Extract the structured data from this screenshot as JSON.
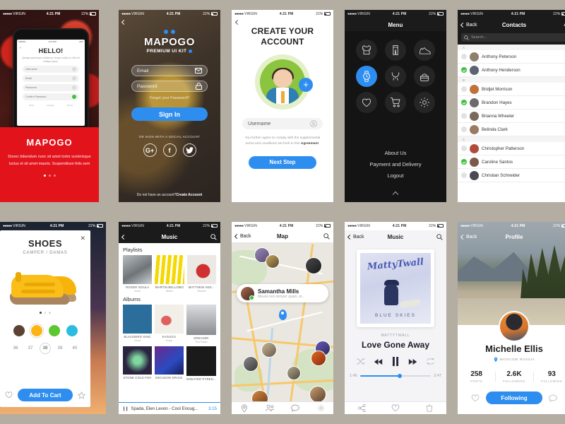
{
  "statusbar": {
    "carrier": "VIRGIN",
    "time": "4:21 PM",
    "battery": "22%",
    "signal_dots": "●●●●●"
  },
  "screen1": {
    "inner": {
      "back_icon": "chevron-left-icon",
      "title": "HELLO!",
      "subtitle": "Quisque justo turpis vestibulum, tempor mollis mi. Sed vel tristique quam.",
      "fields": [
        {
          "label": "Username",
          "icon": "user-icon"
        },
        {
          "label": "Email",
          "icon": "mail-icon"
        },
        {
          "label": "Password",
          "icon": "lock-icon"
        },
        {
          "label": "Confirm Password",
          "icon": "check-icon"
        }
      ],
      "strength": [
        {
          "label": "Weak",
          "color": "#e3131c"
        },
        {
          "label": "Average",
          "color": "#f5a623"
        },
        {
          "label": "Strong",
          "color": "#3ec13e"
        }
      ]
    },
    "card": {
      "title": "MAPOGO",
      "body": "Donec bibendum nunc sit amet tortor scelerisque luctus et sit amet mauris. Suspendisse felis sem",
      "bg_color": "#e3131c"
    }
  },
  "screen2": {
    "back_icon": "chevron-left-icon",
    "title": "MAPOGO",
    "subtitle": "PREMIUM UI KIT",
    "fields": [
      {
        "placeholder": "Email",
        "icon": "mail-icon"
      },
      {
        "placeholder": "Password",
        "icon": "lock-icon"
      }
    ],
    "forgot": "Forgot your Password?",
    "signin": "Sign In",
    "social_prompt": "OR SIGN WITH A SOCIAL ACCOUNT",
    "socials": [
      "G+",
      "f",
      "t"
    ],
    "bottom_text": "Do not have an account?",
    "bottom_link": "Create Account",
    "accent": "#2e8ef0"
  },
  "screen3": {
    "back_icon": "chevron-left-icon",
    "title_line1": "CREATE YOUR",
    "title_line2": "ACCOUNT",
    "add_photo_icon": "plus-icon",
    "field": {
      "placeholder": "Username",
      "icon": "user-icon"
    },
    "terms_prefix": "You further agree to comply with the supplemental terms and conditions set forth in this ",
    "terms_link": "Agreement",
    "terms_suffix": ".",
    "next_button": "Next Step"
  },
  "screen4": {
    "title": "Menu",
    "icons": [
      {
        "name": "shirt-icon",
        "active": false
      },
      {
        "name": "pants-icon",
        "active": false
      },
      {
        "name": "shoe-icon",
        "active": false
      },
      {
        "name": "watch-icon",
        "active": true
      },
      {
        "name": "necklace-icon",
        "active": false
      },
      {
        "name": "handbag-icon",
        "active": false
      },
      {
        "name": "heart-icon",
        "active": false
      },
      {
        "name": "cart-icon",
        "active": false
      },
      {
        "name": "gear-icon",
        "active": false
      }
    ],
    "links": [
      "About Us",
      "Payment and Delivery",
      "Logout"
    ],
    "collapse_icon": "chevron-up-icon",
    "accent": "#2e8ef0"
  },
  "screen5": {
    "back": "Back",
    "title": "Contacts",
    "right_label": "A",
    "search_placeholder": "Search...",
    "sections": [
      {
        "letter": "A",
        "rows": [
          {
            "name": "Anthony Peterson",
            "selected": false,
            "avatar": "#8f7f6e"
          },
          {
            "name": "Anthony Henderson",
            "selected": true,
            "avatar": "#5c6470"
          }
        ]
      },
      {
        "letter": "B",
        "rows": [
          {
            "name": "Bridjet Morrison",
            "selected": false,
            "avatar": "#c0703a"
          },
          {
            "name": "Brandon Hayes",
            "selected": true,
            "avatar": "#6b6b6b"
          },
          {
            "name": "Brianna Wheeler",
            "selected": false,
            "avatar": "#7a6a5e"
          },
          {
            "name": "Belinda Clark",
            "selected": false,
            "avatar": "#9a7a62"
          }
        ]
      },
      {
        "letter": "C",
        "rows": [
          {
            "name": "Christopher Patterson",
            "selected": false,
            "avatar": "#b04a3a"
          },
          {
            "name": "Caroline Santos",
            "selected": true,
            "avatar": "#7c5a4a"
          },
          {
            "name": "Christian Schneider",
            "selected": false,
            "avatar": "#4a4a52"
          }
        ]
      }
    ]
  },
  "screen6": {
    "close_icon": "close-icon",
    "title": "SHOES",
    "subtitle": "CAMPER / DAMAS",
    "colors": [
      {
        "hex": "#5b4233",
        "selected": false
      },
      {
        "hex": "#fcb415",
        "selected": true
      },
      {
        "hex": "#5cc72e",
        "selected": false
      },
      {
        "hex": "#2bbce0",
        "selected": false
      }
    ],
    "sizes": [
      "36",
      "37",
      "38",
      "39",
      "40"
    ],
    "selected_size": "38",
    "heart_icon": "heart-icon",
    "star_icon": "star-icon",
    "cta": "Add To Cart"
  },
  "screen7": {
    "back_icon": "chevron-left-icon",
    "title": "Music",
    "search_icon": "search-icon",
    "playlists_heading": "Playlists",
    "playlists": [
      {
        "title": "ROGER GOULA",
        "sub": "Aves",
        "bg": "#9aa0a4"
      },
      {
        "title": "MARTIN BELLOMO",
        "sub": "Mimic",
        "bg": "#f5d800"
      },
      {
        "title": "MATTHEW AND...",
        "sub": "Temple",
        "bg": "#e8e6e2"
      }
    ],
    "albums_heading": "Albums",
    "albums": [
      {
        "title": "BLACKBIRD SING",
        "sub": "Circa",
        "bg": "#2b6e9c"
      },
      {
        "title": "KAGUGU",
        "sub": "Hope",
        "bg": "#f2eee8"
      },
      {
        "title": "GREAVER",
        "sub": "The Fawn",
        "bg": "#c8cacd"
      },
      {
        "title": "STONE COLD FOX",
        "sub": "",
        "bg": "#2a2440"
      },
      {
        "title": "DECISION SPACE",
        "sub": "",
        "bg": "#6a2a8a"
      },
      {
        "title": "GREATER PYREN...",
        "sub": "",
        "bg": "#1a1a1a"
      }
    ],
    "now_playing": "Spada, Elen Levon - Cool Enoug...",
    "now_playing_time": "3:15",
    "pause_icon": "pause-icon"
  },
  "screen8": {
    "back": "Back",
    "title": "Map",
    "search_icon": "search-icon",
    "card": {
      "name": "Samantha Mills",
      "message": "Mauris non tempor quam, et.."
    },
    "pin_icon": "map-pin-icon",
    "tabs": [
      {
        "icon": "location-icon"
      },
      {
        "icon": "people-icon"
      },
      {
        "icon": "chat-icon"
      },
      {
        "icon": "gear-icon"
      }
    ]
  },
  "screen9": {
    "back": "Back",
    "title": "Music",
    "search_icon": "search-icon",
    "album_script": "MattyTwall",
    "album_title": "BLUE SKIES",
    "artist": "MATTYTWALL",
    "track": "Love Gone Away",
    "controls": [
      {
        "icon": "shuffle-icon",
        "dim": true
      },
      {
        "icon": "previous-icon",
        "dim": false
      },
      {
        "icon": "pause-icon",
        "dim": false
      },
      {
        "icon": "next-icon",
        "dim": false
      },
      {
        "icon": "repeat-icon",
        "dim": true
      }
    ],
    "elapsed": "1:45",
    "total": "2:47",
    "tabs": [
      {
        "icon": "share-icon"
      },
      {
        "icon": "heart-icon"
      },
      {
        "icon": "trash-icon"
      }
    ]
  },
  "screen10": {
    "back": "Back",
    "title": "Profile",
    "name": "Michelle Ellis",
    "location": "MOSCOW RUSSIA",
    "location_icon": "map-pin-icon",
    "stats": [
      {
        "value": "258",
        "label": "POSTS"
      },
      {
        "value": "2.6K",
        "label": "FOLLOWERS"
      },
      {
        "value": "93",
        "label": "FOLLOWING"
      }
    ],
    "heart_icon": "heart-icon",
    "follow_button": "Following",
    "message_icon": "chat-icon"
  }
}
